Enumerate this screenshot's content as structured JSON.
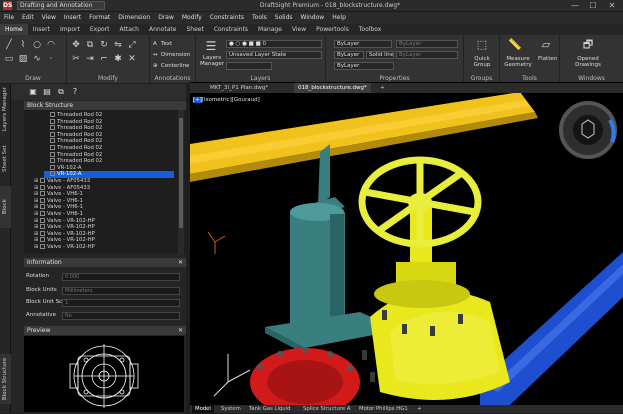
{
  "titlebar": {
    "logo": "DS",
    "workspace": "Drafting and Annotation",
    "title": "DraftSight Premium - 018_blockstructure.dwg*",
    "minimize": "—",
    "maximize": "☐",
    "close": "✕"
  },
  "menu": [
    "File",
    "Edit",
    "View",
    "Insert",
    "Format",
    "Dimension",
    "Draw",
    "Modify",
    "Constraints",
    "Tools",
    "Solids",
    "Window",
    "Help"
  ],
  "ribbon_tabs": [
    "Home",
    "Insert",
    "Import",
    "Export",
    "Attach",
    "Annotate",
    "Sheet",
    "Constraints",
    "Manage",
    "View",
    "Powertools",
    "Toolbox"
  ],
  "ribbon": {
    "groups": [
      "Draw",
      "Modify",
      "Annotations",
      "Layers",
      "Properties",
      "Groups",
      "Tools",
      "Windows"
    ],
    "annotations": [
      "Text",
      "Dimension",
      "Centerline"
    ],
    "layers_manager": "Layers Manager",
    "layer_state": "Unsaved Layer State",
    "bylayer": "ByLayer",
    "solid_line": "Solid line",
    "quick_group": "Quick Group",
    "measure_geometry": "Measure Geometry",
    "flatten": "Flatten",
    "opened_drawings": "Opened Drawings"
  },
  "side_tabs": [
    "Layers Manager",
    "Sheet Set Manager",
    "Block Structure",
    "Block Structure"
  ],
  "panel": {
    "block_structure": "Block Structure",
    "information": "Information",
    "preview": "Preview",
    "close": "✕"
  },
  "tree": [
    {
      "label": "Threaded Rod 02",
      "level": 2,
      "selected": false
    },
    {
      "label": "Threaded Rod 02",
      "level": 2,
      "selected": false
    },
    {
      "label": "Threaded Rod 02",
      "level": 2,
      "selected": false
    },
    {
      "label": "Threaded Rod 02",
      "level": 2,
      "selected": false
    },
    {
      "label": "Threaded Rod 02",
      "level": 2,
      "selected": false
    },
    {
      "label": "Threaded Rod 02",
      "level": 2,
      "selected": false
    },
    {
      "label": "Threaded Rod 02",
      "level": 2,
      "selected": false
    },
    {
      "label": "Threaded Rod 02",
      "level": 2,
      "selected": false
    },
    {
      "label": "VR-102-A",
      "level": 2,
      "selected": false
    },
    {
      "label": "VR-102-A",
      "level": 2,
      "selected": true
    },
    {
      "label": "Valve - AF05433",
      "level": 1,
      "selected": false
    },
    {
      "label": "Valve - AF05433",
      "level": 1,
      "selected": false
    },
    {
      "label": "Valve - VH6-1",
      "level": 1,
      "selected": false
    },
    {
      "label": "Valve - VH6-1",
      "level": 1,
      "selected": false
    },
    {
      "label": "Valve - VH6-1",
      "level": 1,
      "selected": false
    },
    {
      "label": "Valve - VH6-1",
      "level": 1,
      "selected": false
    },
    {
      "label": "Valve - VR-102-HP",
      "level": 1,
      "selected": false
    },
    {
      "label": "Valve - VR-102-HP",
      "level": 1,
      "selected": false
    },
    {
      "label": "Valve - VR-102-HP",
      "level": 1,
      "selected": false
    },
    {
      "label": "Valve - VR-102-HP",
      "level": 1,
      "selected": false
    },
    {
      "label": "Valve - VR-102-HP",
      "level": 1,
      "selected": false
    }
  ],
  "information": [
    {
      "label": "Rotation",
      "value": "0.000"
    },
    {
      "label": "Block Units",
      "value": "Millimeters"
    },
    {
      "label": "Block Unit Scale",
      "value": "1"
    },
    {
      "label": "Annotative",
      "value": "No"
    }
  ],
  "doc_tabs": [
    "MKT_3I_P1 Plan.dwg*",
    "018_blockstructure.dwg*",
    "+"
  ],
  "view_label_tag": "[+]",
  "view_label": "[Isometric][Gouraud]",
  "sheet_tabs": [
    "Model",
    "System",
    "Tank Gas Liquid",
    "Splice Structure A",
    "Motor Phillips HG1",
    "+"
  ],
  "colors": {
    "pipe_yellow": "#f2c21c",
    "pipe_blue": "#1f4fd1",
    "valve_teal": "#3a7f80",
    "valve_yellow": "#e8e81c",
    "flange_red": "#d21a1a",
    "selection": "#1560d8"
  }
}
